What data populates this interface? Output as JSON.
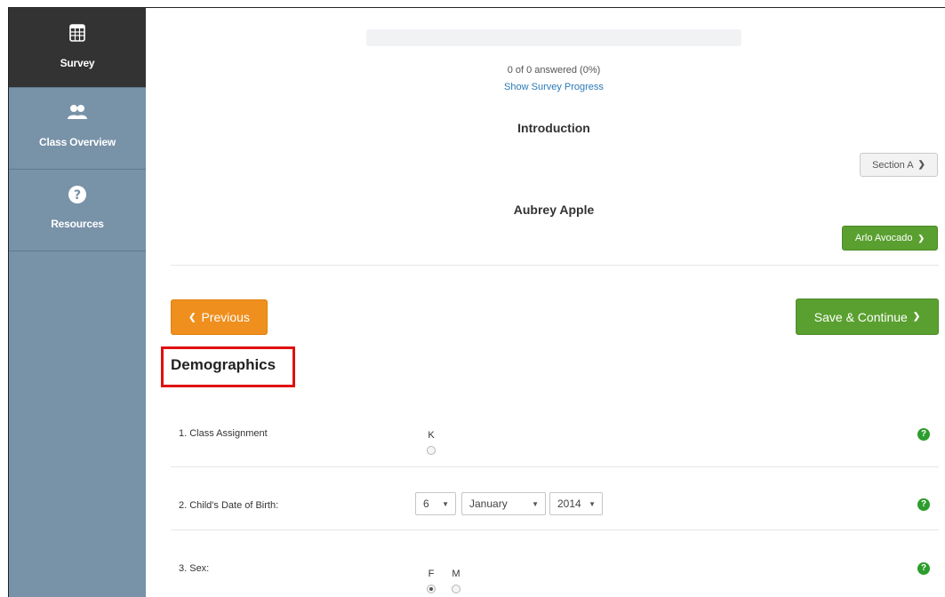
{
  "sidebar": {
    "items": [
      {
        "label": "Survey",
        "icon": "table-icon",
        "active": true
      },
      {
        "label": "Class Overview",
        "icon": "users-icon",
        "active": false
      },
      {
        "label": "Resources",
        "icon": "question-circle-icon",
        "active": false
      }
    ]
  },
  "progress": {
    "percent": 0,
    "text": "0 of 0 answered (0%)",
    "link": "Show Survey Progress"
  },
  "section": {
    "title": "Introduction",
    "next_section_label": "Section A"
  },
  "student": {
    "name": "Aubrey Apple",
    "next_student_label": "Arlo Avocado"
  },
  "nav": {
    "previous_label": "Previous",
    "save_label": "Save & Continue"
  },
  "demographics": {
    "heading": "Demographics",
    "questions": [
      {
        "label": "1. Class Assignment",
        "options": [
          "K"
        ]
      },
      {
        "label": "2. Child's Date of Birth:",
        "day": "6",
        "month": "January",
        "year": "2014"
      },
      {
        "label": "3. Sex:",
        "options": [
          "F",
          "M"
        ],
        "selected": "F"
      }
    ],
    "help_glyph": "?"
  },
  "colors": {
    "sidebar_bg": "#7892a8",
    "sidebar_active": "#333333",
    "primary_green": "#5aa030",
    "previous_orange": "#ef8f1d",
    "highlight_red": "#e01010",
    "link_blue": "#2a7ab8"
  }
}
